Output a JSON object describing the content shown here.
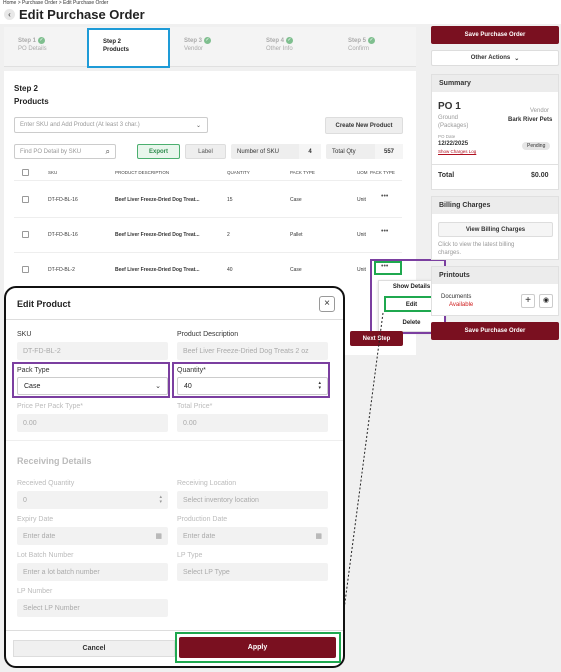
{
  "breadcrumb": "Home > Purchase Order > Edit Purchase Order",
  "page_title": "Edit Purchase Order",
  "steps": [
    {
      "name": "Step 1",
      "sub": "PO Details"
    },
    {
      "name": "Step 2",
      "sub": "Products"
    },
    {
      "name": "Step 3",
      "sub": "Vendor"
    },
    {
      "name": "Step 4",
      "sub": "Other Info"
    },
    {
      "name": "Step 5",
      "sub": "Confirm"
    }
  ],
  "section": {
    "step": "Step 2",
    "title": "Products"
  },
  "sku_search_placeholder": "Enter SKU and Add Product (At least 3 char.)",
  "create_product_label": "Create New Product",
  "find_po_placeholder": "Find PO Detail by SKU",
  "export_label": "Export",
  "label_label": "Label",
  "stats": {
    "sku_label": "Number of SKU",
    "sku_value": "4",
    "qty_label": "Total Qty",
    "qty_value": "557"
  },
  "table": {
    "headers": [
      "SKU",
      "PRODUCT DESCRIPTION",
      "QUANTITY",
      "PACK TYPE",
      "UOM",
      "PACK TYPE"
    ],
    "rows": [
      {
        "sku": "DT-FD-BL-16",
        "desc": "Beef Liver Freeze-Dried Dog Treat...",
        "qty": "15",
        "pack": "Case",
        "uom": "Unit"
      },
      {
        "sku": "DT-FD-BL-16",
        "desc": "Beef Liver Freeze-Dried Dog Treat...",
        "qty": "2",
        "pack": "Pallet",
        "uom": "Unit"
      },
      {
        "sku": "DT-FD-BL-2",
        "desc": "Beef Liver Freeze-Dried Dog Treat...",
        "qty": "40",
        "pack": "Case",
        "uom": "Unit"
      }
    ],
    "more_glyph": "•••"
  },
  "actions_menu": [
    "Show Details",
    "Edit",
    "Delete"
  ],
  "next_step_label": "Next Step",
  "right": {
    "save_label": "Save Purchase Order",
    "other_actions_label": "Other Actions",
    "summary_title": "Summary",
    "po_number": "PO 1",
    "shipping_1": "Ground",
    "shipping_2": "(Packages)",
    "vendor_label": "Vendor",
    "vendor_name": "Bark River Pets",
    "po_date_label": "PO Date",
    "po_date": "12/22/2025",
    "show_charges": "Show Charges Log",
    "status": "Pending",
    "total_label": "Total",
    "total_value": "$0.00",
    "billing_title": "Billing Charges",
    "view_billing_label": "View Billing Charges",
    "billing_hint_1": "Click to view the latest billing",
    "billing_hint_2": "charges.",
    "printouts_title": "Printouts",
    "documents_label": "Documents",
    "available_label": "Available"
  },
  "modal": {
    "title": "Edit Product",
    "sku_label": "SKU",
    "sku_value": "DT-FD-BL-2",
    "desc_label": "Product Description",
    "desc_value": "Beef Liver Freeze-Dried Dog Treats 2 oz",
    "pack_label": "Pack Type",
    "pack_value": "Case",
    "qty_label": "Quantity*",
    "qty_value": "40",
    "price_label": "Price Per Pack Type*",
    "price_value": "0.00",
    "total_label": "Total Price*",
    "total_value": "0.00",
    "receiving_title": "Receiving Details",
    "recv_qty_label": "Received Quantity",
    "recv_qty_value": "0",
    "recv_loc_label": "Receiving Location",
    "recv_loc_placeholder": "Select inventory location",
    "expiry_label": "Expiry Date",
    "expiry_placeholder": "Enter date",
    "prod_date_label": "Production Date",
    "prod_date_placeholder": "Enter date",
    "lot_label": "Lot Batch Number",
    "lot_placeholder": "Enter a lot batch number",
    "lp_type_label": "LP Type",
    "lp_type_placeholder": "Select LP Type",
    "lp_num_label": "LP Number",
    "lp_num_placeholder": "Select LP Number",
    "cancel_label": "Cancel",
    "apply_label": "Apply"
  },
  "colors": {
    "brand": "#7a1020",
    "highlight_blue": "#1e9bd7",
    "highlight_purple": "#7b3fa0",
    "highlight_green": "#1fa84f"
  }
}
